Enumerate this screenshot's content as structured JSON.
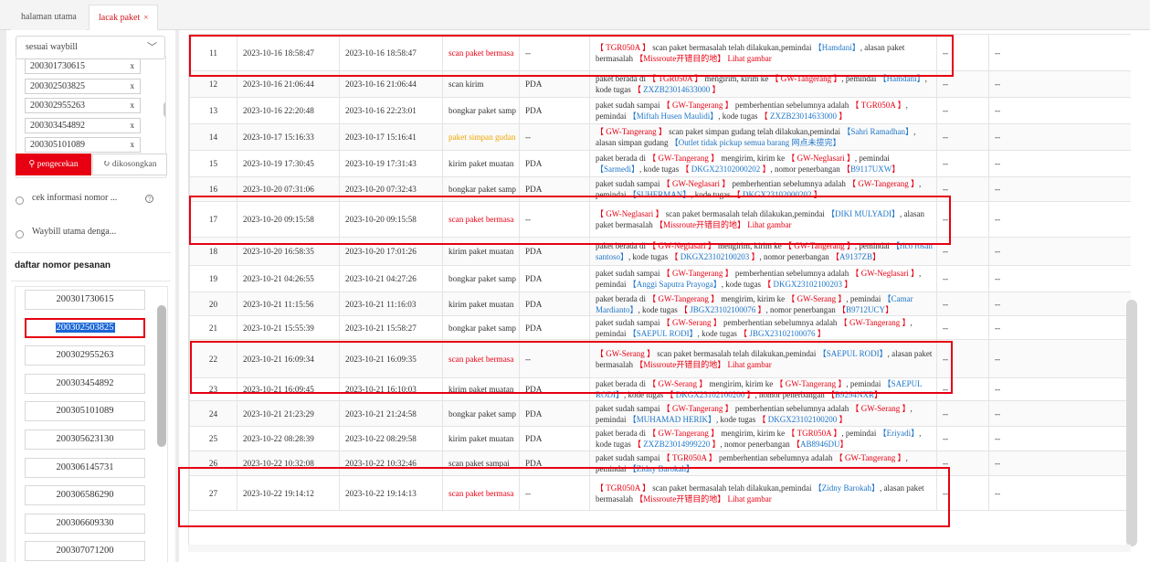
{
  "tabs": [
    {
      "label": "halaman utama"
    },
    {
      "label": "lacak paket",
      "close": "×"
    }
  ],
  "sidebar": {
    "mode_select": "sesuai waybill",
    "waybills": [
      "200301730615",
      "200302503825",
      "200302955263",
      "200303454892",
      "200305101089"
    ],
    "chip_close": "x",
    "search_button": "pengecekan",
    "clear_button": "dikosongkan",
    "radio1": "cek informasi nomor ...",
    "radio2": "Waybill utama denga...",
    "order_list_title": "daftar nomor pesanan",
    "orders": [
      "200301730615",
      "200302503825",
      "200302955263",
      "200303454892",
      "200305101089",
      "200305623130",
      "200306145731",
      "200306586290",
      "200306609330",
      "200307071200"
    ],
    "selected_order": "200302503825"
  },
  "table": {
    "rows": [
      {
        "no": "11",
        "t1": "2023-10-16 18:58:47",
        "t2": "2023-10-16 18:58:47",
        "type": "scan paket bermasa",
        "cls": "red",
        "dev": "--",
        "detail": [
          [
            "r",
            "【 TGR050A 】"
          ],
          [
            "t",
            " scan paket bermasalah telah dilakukan,pemindai "
          ],
          [
            "b",
            "【Hamdani】"
          ],
          [
            "t",
            ", alasan paket bermasalah "
          ],
          [
            "r",
            "【Missroute开错目的地】"
          ],
          [
            "t",
            "  "
          ],
          [
            "r",
            "Lihat gambar"
          ]
        ],
        "c1": "--",
        "c2": "--"
      },
      {
        "no": "12",
        "t1": "2023-10-16 21:06:44",
        "t2": "2023-10-16 21:06:44",
        "type": "scan kirim",
        "cls": "",
        "dev": "PDA",
        "detail": [
          [
            "t",
            "paket berada di "
          ],
          [
            "r",
            "【 TGR050A 】"
          ],
          [
            "t",
            " mengirim, kirim ke "
          ],
          [
            "r",
            "【 GW-Tangerang 】"
          ],
          [
            "t",
            ", pemindai "
          ],
          [
            "b",
            "【Hamdani】"
          ],
          [
            "t",
            ", kode tugas "
          ],
          [
            "r",
            "【 "
          ],
          [
            "b",
            "ZXZB23014633000"
          ],
          [
            "r",
            " 】"
          ]
        ],
        "c1": "--",
        "c2": "--"
      },
      {
        "no": "13",
        "t1": "2023-10-16 22:20:48",
        "t2": "2023-10-16 22:23:01",
        "type": "bongkar paket samp",
        "cls": "",
        "dev": "PDA",
        "detail": [
          [
            "t",
            "paket sudah sampai "
          ],
          [
            "r",
            "【 GW-Tangerang 】"
          ],
          [
            "t",
            " pemberhentian sebelumnya adalah "
          ],
          [
            "r",
            "【 TGR050A 】"
          ],
          [
            "t",
            ", pemindai "
          ],
          [
            "b",
            "【Miftah Husen Maulidi】"
          ],
          [
            "t",
            ", kode tugas "
          ],
          [
            "r",
            "【 "
          ],
          [
            "b",
            "ZXZB23014633000"
          ],
          [
            "r",
            " 】"
          ]
        ],
        "c1": "--",
        "c2": "--"
      },
      {
        "no": "14",
        "t1": "2023-10-17 15:16:33",
        "t2": "2023-10-17 15:16:41",
        "type": "paket simpan gudan",
        "cls": "yel",
        "dev": "--",
        "detail": [
          [
            "r",
            "【 GW-Tangerang 】"
          ],
          [
            "t",
            " scan paket simpan gudang telah dilakukan,pemindai "
          ],
          [
            "b",
            "【Sahri Ramadhan】"
          ],
          [
            "t",
            ", alasan simpan gudang "
          ],
          [
            "b",
            "【Outlet tidak pickup semua barang 网点未揽完】"
          ]
        ],
        "c1": "--",
        "c2": "--"
      },
      {
        "no": "15",
        "t1": "2023-10-19 17:30:45",
        "t2": "2023-10-19 17:31:43",
        "type": "kirim paket muatan",
        "cls": "",
        "dev": "PDA",
        "detail": [
          [
            "t",
            "paket berada di "
          ],
          [
            "r",
            "【 GW-Tangerang 】"
          ],
          [
            "t",
            " mengirim, kirim ke "
          ],
          [
            "r",
            "【 GW-Neglasari 】"
          ],
          [
            "t",
            ", pemindai "
          ],
          [
            "b",
            "【Sarmedi】"
          ],
          [
            "t",
            ", kode tugas "
          ],
          [
            "r",
            "【 "
          ],
          [
            "b",
            "DKGX23102000202"
          ],
          [
            "r",
            " 】"
          ],
          [
            "t",
            ", nomor penerbangan "
          ],
          [
            "r",
            "【"
          ],
          [
            "b",
            "B9117UXW"
          ],
          [
            "r",
            "】"
          ]
        ],
        "c1": "--",
        "c2": "--"
      },
      {
        "no": "16",
        "t1": "2023-10-20 07:31:06",
        "t2": "2023-10-20 07:32:43",
        "type": "bongkar paket samp",
        "cls": "",
        "dev": "PDA",
        "detail": [
          [
            "t",
            "paket sudah sampai "
          ],
          [
            "r",
            "【 GW-Neglasari 】"
          ],
          [
            "t",
            " pemberhentian sebelumnya adalah "
          ],
          [
            "r",
            "【 GW-Tangerang 】"
          ],
          [
            "t",
            ", pemindai "
          ],
          [
            "b",
            "【SUHERMAN】"
          ],
          [
            "t",
            ", kode tugas "
          ],
          [
            "r",
            "【 "
          ],
          [
            "b",
            "DKGX23102000202"
          ],
          [
            "r",
            " 】"
          ]
        ],
        "c1": "--",
        "c2": "--"
      },
      {
        "no": "17",
        "t1": "2023-10-20 09:15:58",
        "t2": "2023-10-20 09:15:58",
        "type": "scan paket bermasa",
        "cls": "red",
        "dev": "--",
        "detail": [
          [
            "r",
            "【 GW-Neglasari 】"
          ],
          [
            "t",
            " scan paket bermasalah telah dilakukan,pemindai "
          ],
          [
            "b",
            "【DIKI MULYADI】"
          ],
          [
            "t",
            ", alasan paket bermasalah "
          ],
          [
            "r",
            "【Missroute开错目的地】"
          ],
          [
            "t",
            "  "
          ],
          [
            "r",
            "Lihat gambar"
          ]
        ],
        "c1": "--",
        "c2": "--"
      },
      {
        "no": "18",
        "t1": "2023-10-20 16:58:35",
        "t2": "2023-10-20 17:01:26",
        "type": "kirim paket muatan",
        "cls": "",
        "dev": "PDA",
        "detail": [
          [
            "t",
            "paket berada di "
          ],
          [
            "r",
            "【 GW-Neglasari 】"
          ],
          [
            "t",
            " mengirim, kirim ke "
          ],
          [
            "r",
            "【 GW-Tangerang 】"
          ],
          [
            "t",
            ", pemindai "
          ],
          [
            "b",
            "【rico rosan santoso】"
          ],
          [
            "t",
            ", kode tugas "
          ],
          [
            "r",
            "【 "
          ],
          [
            "b",
            "DKGX23102100203"
          ],
          [
            "r",
            " 】"
          ],
          [
            "t",
            ", nomor penerbangan "
          ],
          [
            "r",
            "【"
          ],
          [
            "b",
            "A9137ZB"
          ],
          [
            "r",
            "】"
          ]
        ],
        "c1": "--",
        "c2": "--"
      },
      {
        "no": "19",
        "t1": "2023-10-21 04:26:55",
        "t2": "2023-10-21 04:27:26",
        "type": "bongkar paket samp",
        "cls": "",
        "dev": "PDA",
        "detail": [
          [
            "t",
            "paket sudah sampai "
          ],
          [
            "r",
            "【 GW-Tangerang 】"
          ],
          [
            "t",
            " pemberhentian sebelumnya adalah "
          ],
          [
            "r",
            "【 GW-Neglasari 】"
          ],
          [
            "t",
            ", pemindai "
          ],
          [
            "b",
            "【Anggi Saputra Prayoga】"
          ],
          [
            "t",
            ", kode tugas "
          ],
          [
            "r",
            "【 "
          ],
          [
            "b",
            "DKGX23102100203"
          ],
          [
            "r",
            " 】"
          ]
        ],
        "c1": "--",
        "c2": "--"
      },
      {
        "no": "20",
        "t1": "2023-10-21 11:15:56",
        "t2": "2023-10-21 11:16:03",
        "type": "kirim paket muatan",
        "cls": "",
        "dev": "PDA",
        "detail": [
          [
            "t",
            "paket berada di "
          ],
          [
            "r",
            "【 GW-Tangerang 】"
          ],
          [
            "t",
            " mengirim, kirim ke "
          ],
          [
            "r",
            "【 GW-Serang 】"
          ],
          [
            "t",
            ", pemindai "
          ],
          [
            "b",
            "【Camar Mardianto】"
          ],
          [
            "t",
            ", kode tugas "
          ],
          [
            "r",
            "【 "
          ],
          [
            "b",
            "JBGX23102100076"
          ],
          [
            "r",
            " 】"
          ],
          [
            "t",
            ", nomor penerbangan "
          ],
          [
            "r",
            "【"
          ],
          [
            "b",
            "B9712UCY"
          ],
          [
            "r",
            "】"
          ]
        ],
        "c1": "--",
        "c2": "--"
      },
      {
        "no": "21",
        "t1": "2023-10-21 15:55:39",
        "t2": "2023-10-21 15:58:27",
        "type": "bongkar paket samp",
        "cls": "",
        "dev": "PDA",
        "detail": [
          [
            "t",
            "paket sudah sampai "
          ],
          [
            "r",
            "【 GW-Serang 】"
          ],
          [
            "t",
            " pemberhentian sebelumnya adalah "
          ],
          [
            "r",
            "【 GW-Tangerang 】"
          ],
          [
            "t",
            ", pemindai "
          ],
          [
            "b",
            "【SAEPUL RODI】"
          ],
          [
            "t",
            ", kode tugas "
          ],
          [
            "r",
            "【 "
          ],
          [
            "b",
            "JBGX23102100076"
          ],
          [
            "r",
            " 】"
          ]
        ],
        "c1": "--",
        "c2": "--"
      },
      {
        "no": "22",
        "t1": "2023-10-21 16:09:34",
        "t2": "2023-10-21 16:09:35",
        "type": "scan paket bermasa",
        "cls": "red",
        "dev": "--",
        "detail": [
          [
            "r",
            "【 GW-Serang 】"
          ],
          [
            "t",
            " scan paket bermasalah telah dilakukan,pemindai "
          ],
          [
            "b",
            "【SAEPUL RODI】"
          ],
          [
            "t",
            ", alasan paket bermasalah "
          ],
          [
            "r",
            "【Missroute开错目的地】"
          ],
          [
            "t",
            "  "
          ],
          [
            "r",
            "Lihat gambar"
          ]
        ],
        "c1": "--",
        "c2": "--"
      },
      {
        "no": "23",
        "t1": "2023-10-21 16:09:45",
        "t2": "2023-10-21 16:10:03",
        "type": "kirim paket muatan",
        "cls": "",
        "dev": "PDA",
        "detail": [
          [
            "t",
            "paket berada di "
          ],
          [
            "r",
            "【 GW-Serang 】"
          ],
          [
            "t",
            " mengirim, kirim ke "
          ],
          [
            "r",
            "【 GW-Tangerang 】"
          ],
          [
            "t",
            ", pemindai "
          ],
          [
            "b",
            "【SAEPUL RODI】"
          ],
          [
            "t",
            ", kode tugas "
          ],
          [
            "r",
            "【 "
          ],
          [
            "b",
            "DKGX23102100200"
          ],
          [
            "r",
            " 】"
          ],
          [
            "t",
            ", nomor penerbangan "
          ],
          [
            "r",
            "【"
          ],
          [
            "b",
            "B9294NXR"
          ],
          [
            "r",
            "】"
          ]
        ],
        "c1": "--",
        "c2": "--"
      },
      {
        "no": "24",
        "t1": "2023-10-21 21:23:29",
        "t2": "2023-10-21 21:24:58",
        "type": "bongkar paket samp",
        "cls": "",
        "dev": "PDA",
        "detail": [
          [
            "t",
            "paket sudah sampai "
          ],
          [
            "r",
            "【 GW-Tangerang 】"
          ],
          [
            "t",
            " pemberhentian sebelumnya adalah "
          ],
          [
            "r",
            "【 GW-Serang 】"
          ],
          [
            "t",
            ", pemindai "
          ],
          [
            "b",
            "【MUHAMAD HERIK】"
          ],
          [
            "t",
            ", kode tugas "
          ],
          [
            "r",
            "【 "
          ],
          [
            "b",
            "DKGX23102100200"
          ],
          [
            "r",
            " 】"
          ]
        ],
        "c1": "--",
        "c2": "--"
      },
      {
        "no": "25",
        "t1": "2023-10-22 08:28:39",
        "t2": "2023-10-22 08:29:58",
        "type": "kirim paket muatan",
        "cls": "",
        "dev": "PDA",
        "detail": [
          [
            "t",
            "paket berada di "
          ],
          [
            "r",
            "【 GW-Tangerang 】"
          ],
          [
            "t",
            " mengirim, kirim ke "
          ],
          [
            "r",
            "【 TGR050A 】"
          ],
          [
            "t",
            ", pemindai "
          ],
          [
            "b",
            "【Eriyadi】"
          ],
          [
            "t",
            ", kode tugas "
          ],
          [
            "r",
            "【 "
          ],
          [
            "b",
            "ZXZB23014999220"
          ],
          [
            "r",
            " 】"
          ],
          [
            "t",
            ", nomor penerbangan "
          ],
          [
            "r",
            "【"
          ],
          [
            "b",
            "AB8946DU"
          ],
          [
            "r",
            "】"
          ]
        ],
        "c1": "--",
        "c2": "--"
      },
      {
        "no": "26",
        "t1": "2023-10-22 10:32:08",
        "t2": "2023-10-22 10:32:46",
        "type": "scan paket sampai",
        "cls": "",
        "dev": "PDA",
        "detail": [
          [
            "t",
            "paket sudah sampai "
          ],
          [
            "r",
            "【 TGR050A 】"
          ],
          [
            "t",
            " pemberhentian sebelumnya adalah "
          ],
          [
            "r",
            "【 GW-Tangerang 】"
          ],
          [
            "t",
            ", pemindai "
          ],
          [
            "b",
            "【Zidny Barokah】"
          ]
        ],
        "c1": "--",
        "c2": "--"
      },
      {
        "no": "27",
        "t1": "2023-10-22 19:14:12",
        "t2": "2023-10-22 19:14:13",
        "type": "scan paket bermasa",
        "cls": "red",
        "dev": "--",
        "detail": [
          [
            "r",
            "【 TGR050A 】"
          ],
          [
            "t",
            " scan paket bermasalah telah dilakukan,pemindai "
          ],
          [
            "b",
            "【Zidny Barokah】"
          ],
          [
            "t",
            ", alasan paket bermasalah "
          ],
          [
            "r",
            "【Missroute开错目的地】"
          ],
          [
            "t",
            "  "
          ],
          [
            "r",
            "Lihat gambar"
          ]
        ],
        "c1": "--",
        "c2": "--"
      }
    ]
  },
  "colors": {
    "accent": "#e60012",
    "link": "#1f76c8",
    "warning": "#f0a500",
    "selection": "#1a66d6"
  }
}
